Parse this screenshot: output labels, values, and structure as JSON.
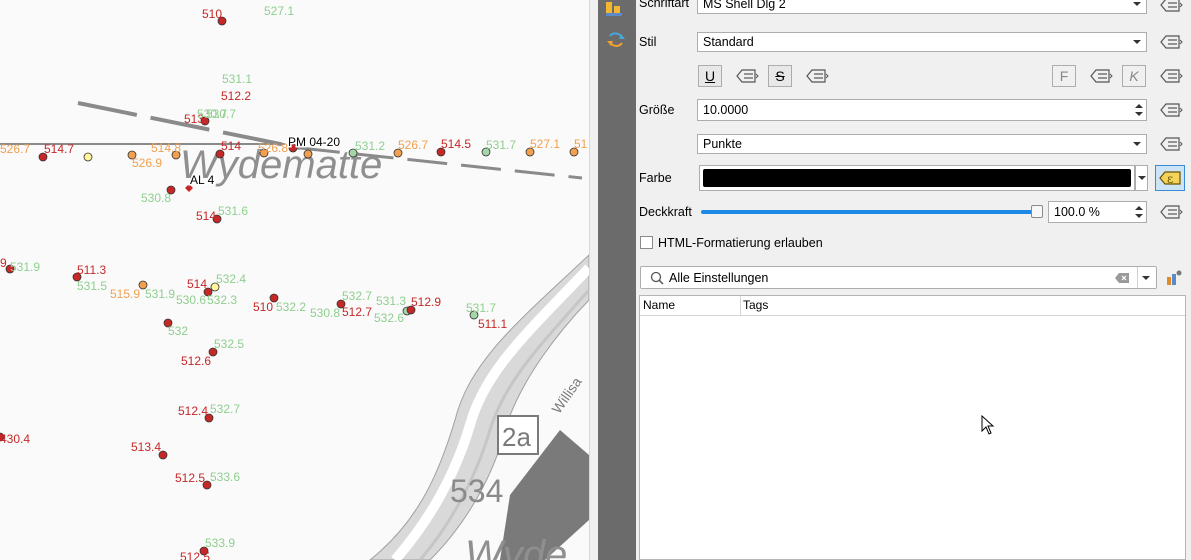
{
  "map": {
    "place_name": "Wydematte",
    "place_name_bottom": "Wyde",
    "road_label": "Willisa",
    "road_badge": "2a",
    "contour_label": "534",
    "marker_labels": [
      {
        "text": "PM 04-20"
      },
      {
        "text": "AL 4"
      }
    ],
    "red_labels": [
      "510",
      "512.2",
      "513",
      "514",
      "514.7",
      "514.5",
      "514",
      "511.3",
      "514",
      "510",
      "512.7",
      "512.9",
      "511.1",
      "512.6",
      "512.4",
      "513.4",
      "512.5",
      "512.5",
      "430.4",
      "9"
    ],
    "green_labels": [
      "527.1",
      "531.1",
      "530.7",
      "531.2",
      "531.7",
      "531.6",
      "531.9",
      "531.5",
      "531.9",
      "530.6",
      "532.3",
      "532.4",
      "532.2",
      "530.8",
      "532.7",
      "531.3",
      "532.6",
      "531.7",
      "532",
      "532.5",
      "532.7",
      "533.6",
      "533.9",
      "530.8",
      "530.7"
    ],
    "orange_labels": [
      "526.7",
      "526.9",
      "514.8",
      "526.7",
      "527.1",
      "515.9",
      "526.8",
      "51"
    ]
  },
  "panel": {
    "font_label": "Schriftart",
    "font_value": "MS Shell Dlg 2",
    "style_label": "Stil",
    "style_value": "Standard",
    "underline_label": "U",
    "strike_label": "S",
    "bold_label": "F",
    "italic_label": "K",
    "size_label": "Größe",
    "size_value": "10.0000",
    "unit_value": "Punkte",
    "color_label": "Farbe",
    "color_value": "#000000",
    "opacity_label": "Deckkraft",
    "opacity_value": "100.0 %",
    "opacity_fraction": 1.0,
    "html_label": "HTML-Formatierung erlauben",
    "html_checked": false,
    "search_placeholder": "Alle Einstellungen",
    "table_headers": [
      "Name",
      "Tags"
    ]
  }
}
